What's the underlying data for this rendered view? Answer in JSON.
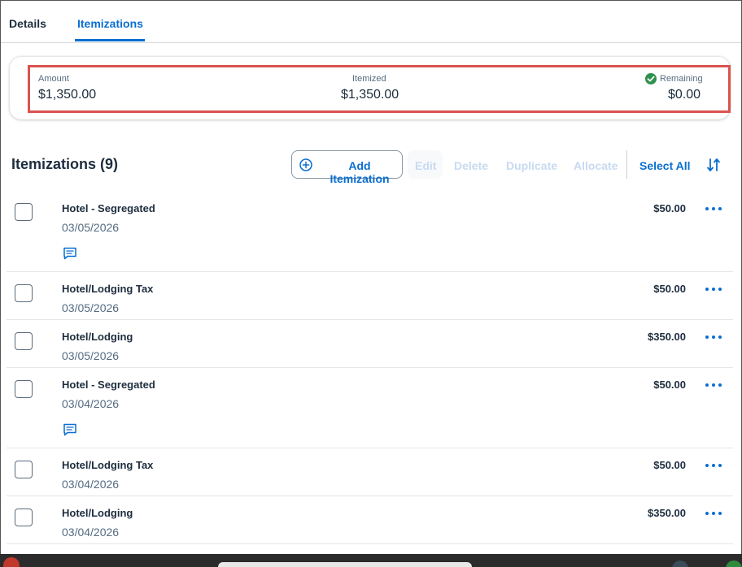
{
  "tabs": [
    {
      "label": "Details",
      "active": false
    },
    {
      "label": "Itemizations",
      "active": true
    }
  ],
  "summary": {
    "amount_label": "Amount",
    "amount_value": "$1,350.00",
    "itemized_label": "Itemized",
    "itemized_value": "$1,350.00",
    "remaining_label": "Remaining",
    "remaining_value": "$0.00",
    "remaining_status_icon": "check-circle-icon"
  },
  "toolbar": {
    "title": "Itemizations (9)",
    "add_label": "Add Itemization",
    "edit_label": "Edit",
    "delete_label": "Delete",
    "duplicate_label": "Duplicate",
    "allocate_label": "Allocate",
    "select_all_label": "Select All"
  },
  "items": [
    {
      "name": "Hotel - Segregated",
      "date": "03/05/2026",
      "amount": "$50.00",
      "has_comment": true
    },
    {
      "name": "Hotel/Lodging Tax",
      "date": "03/05/2026",
      "amount": "$50.00",
      "has_comment": false
    },
    {
      "name": "Hotel/Lodging",
      "date": "03/05/2026",
      "amount": "$350.00",
      "has_comment": false
    },
    {
      "name": "Hotel - Segregated",
      "date": "03/04/2026",
      "amount": "$50.00",
      "has_comment": true
    },
    {
      "name": "Hotel/Lodging Tax",
      "date": "03/04/2026",
      "amount": "$50.00",
      "has_comment": false
    },
    {
      "name": "Hotel/Lodging",
      "date": "03/04/2026",
      "amount": "$350.00",
      "has_comment": false
    }
  ],
  "colors": {
    "accent": "#0a6ed1",
    "success": "#30914c",
    "highlight": "#d9534f",
    "disabled": "#c7daf0"
  }
}
